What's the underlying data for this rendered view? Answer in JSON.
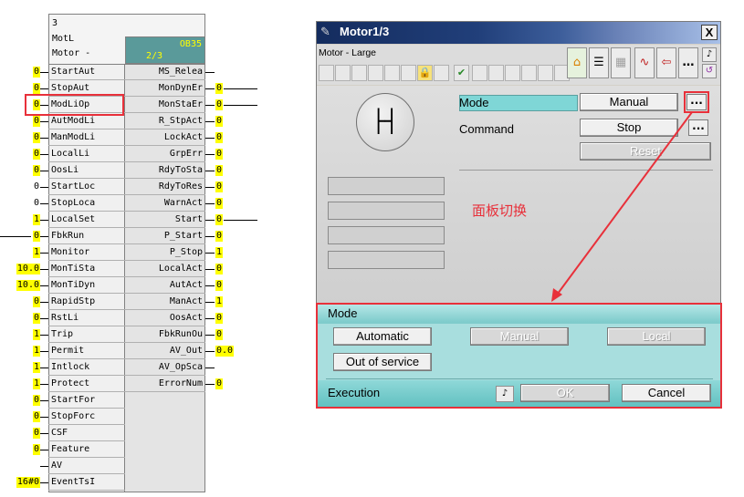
{
  "function_block": {
    "header_lines": [
      "3",
      "MotL",
      "Motor -"
    ],
    "ob_label": "OB35",
    "page_label": "2/3",
    "inputs": [
      {
        "name": "StartAut",
        "value": "0",
        "highlight": true
      },
      {
        "name": "StopAut",
        "value": "0",
        "highlight": true
      },
      {
        "name": "ModLiOp",
        "value": "0",
        "highlight": true
      },
      {
        "name": "AutModLi",
        "value": "0",
        "highlight": true
      },
      {
        "name": "ManModLi",
        "value": "0",
        "highlight": true
      },
      {
        "name": "LocalLi",
        "value": "0",
        "highlight": true
      },
      {
        "name": "OosLi",
        "value": "0",
        "highlight": true
      },
      {
        "name": "StartLoc",
        "value": "0",
        "highlight": false
      },
      {
        "name": "StopLoca",
        "value": "0",
        "highlight": false
      },
      {
        "name": "LocalSet",
        "value": "1",
        "highlight": true
      },
      {
        "name": "FbkRun",
        "value": "0",
        "highlight": true
      },
      {
        "name": "Monitor",
        "value": "1",
        "highlight": true
      },
      {
        "name": "MonTiSta",
        "value": "10.0",
        "highlight": true
      },
      {
        "name": "MonTiDyn",
        "value": "10.0",
        "highlight": true
      },
      {
        "name": "RapidStp",
        "value": "0",
        "highlight": true
      },
      {
        "name": "RstLi",
        "value": "0",
        "highlight": true
      },
      {
        "name": "Trip",
        "value": "1",
        "highlight": true
      },
      {
        "name": "Permit",
        "value": "1",
        "highlight": true
      },
      {
        "name": "Intlock",
        "value": "1",
        "highlight": true
      },
      {
        "name": "Protect",
        "value": "1",
        "highlight": true
      },
      {
        "name": "StartFor",
        "value": "0",
        "highlight": true
      },
      {
        "name": "StopForc",
        "value": "0",
        "highlight": true
      },
      {
        "name": "CSF",
        "value": "0",
        "highlight": true
      },
      {
        "name": "Feature",
        "value": "0",
        "highlight": true
      },
      {
        "name": "AV",
        "value": "",
        "highlight": false
      },
      {
        "name": "EventTsI",
        "value": "16#0",
        "highlight": true
      }
    ],
    "outputs": [
      {
        "name": "MS_Relea",
        "value": "",
        "highlight": false
      },
      {
        "name": "MonDynEr",
        "value": "0",
        "highlight": true
      },
      {
        "name": "MonStaEr",
        "value": "0",
        "highlight": true
      },
      {
        "name": "R_StpAct",
        "value": "0",
        "highlight": true
      },
      {
        "name": "LockAct",
        "value": "0",
        "highlight": true
      },
      {
        "name": "GrpErr",
        "value": "0",
        "highlight": true
      },
      {
        "name": "RdyToSta",
        "value": "0",
        "highlight": true
      },
      {
        "name": "RdyToRes",
        "value": "0",
        "highlight": true
      },
      {
        "name": "WarnAct",
        "value": "0",
        "highlight": true
      },
      {
        "name": "Start",
        "value": "0",
        "highlight": true
      },
      {
        "name": "P_Start",
        "value": "0",
        "highlight": true
      },
      {
        "name": "P_Stop",
        "value": "1",
        "highlight": true
      },
      {
        "name": "LocalAct",
        "value": "0",
        "highlight": true
      },
      {
        "name": "AutAct",
        "value": "0",
        "highlight": true
      },
      {
        "name": "ManAct",
        "value": "1",
        "highlight": true
      },
      {
        "name": "OosAct",
        "value": "0",
        "highlight": true
      },
      {
        "name": "FbkRunOu",
        "value": "0",
        "highlight": true
      },
      {
        "name": "AV_Out",
        "value": "0.0",
        "highlight": true
      },
      {
        "name": "AV_OpSca",
        "value": "",
        "highlight": false
      },
      {
        "name": "ErrorNum",
        "value": "0",
        "highlight": true
      }
    ]
  },
  "faceplate": {
    "title": "Motor1/3",
    "close_label": "X",
    "subtitle": "Motor - Large",
    "mode_label": "Mode",
    "mode_value": "Manual",
    "command_label": "Command",
    "command_value": "Stop",
    "reset_label": "Reset",
    "more_label": "...",
    "annotation": "面板切换",
    "mode_panel": {
      "title": "Mode",
      "automatic": "Automatic",
      "manual": "Manual",
      "local": "Local",
      "out_of_service": "Out of service",
      "execution_label": "Execution",
      "ok": "OK",
      "cancel": "Cancel"
    }
  },
  "colors": {
    "highlight": "#ffff00",
    "annotation_red": "#e8303a",
    "panel_teal": "#7fcccc",
    "title_dark": "#142c5e"
  }
}
